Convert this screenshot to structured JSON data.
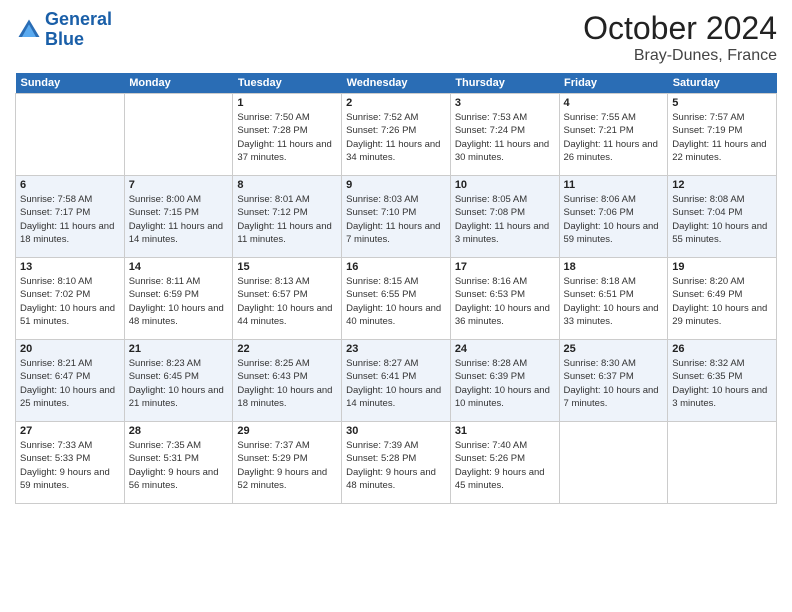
{
  "logo": {
    "line1": "General",
    "line2": "Blue"
  },
  "title": "October 2024",
  "location": "Bray-Dunes, France",
  "headers": [
    "Sunday",
    "Monday",
    "Tuesday",
    "Wednesday",
    "Thursday",
    "Friday",
    "Saturday"
  ],
  "weeks": [
    [
      {
        "date": "",
        "sunrise": "",
        "sunset": "",
        "daylight": ""
      },
      {
        "date": "",
        "sunrise": "",
        "sunset": "",
        "daylight": ""
      },
      {
        "date": "1",
        "sunrise": "Sunrise: 7:50 AM",
        "sunset": "Sunset: 7:28 PM",
        "daylight": "Daylight: 11 hours and 37 minutes."
      },
      {
        "date": "2",
        "sunrise": "Sunrise: 7:52 AM",
        "sunset": "Sunset: 7:26 PM",
        "daylight": "Daylight: 11 hours and 34 minutes."
      },
      {
        "date": "3",
        "sunrise": "Sunrise: 7:53 AM",
        "sunset": "Sunset: 7:24 PM",
        "daylight": "Daylight: 11 hours and 30 minutes."
      },
      {
        "date": "4",
        "sunrise": "Sunrise: 7:55 AM",
        "sunset": "Sunset: 7:21 PM",
        "daylight": "Daylight: 11 hours and 26 minutes."
      },
      {
        "date": "5",
        "sunrise": "Sunrise: 7:57 AM",
        "sunset": "Sunset: 7:19 PM",
        "daylight": "Daylight: 11 hours and 22 minutes."
      }
    ],
    [
      {
        "date": "6",
        "sunrise": "Sunrise: 7:58 AM",
        "sunset": "Sunset: 7:17 PM",
        "daylight": "Daylight: 11 hours and 18 minutes."
      },
      {
        "date": "7",
        "sunrise": "Sunrise: 8:00 AM",
        "sunset": "Sunset: 7:15 PM",
        "daylight": "Daylight: 11 hours and 14 minutes."
      },
      {
        "date": "8",
        "sunrise": "Sunrise: 8:01 AM",
        "sunset": "Sunset: 7:12 PM",
        "daylight": "Daylight: 11 hours and 11 minutes."
      },
      {
        "date": "9",
        "sunrise": "Sunrise: 8:03 AM",
        "sunset": "Sunset: 7:10 PM",
        "daylight": "Daylight: 11 hours and 7 minutes."
      },
      {
        "date": "10",
        "sunrise": "Sunrise: 8:05 AM",
        "sunset": "Sunset: 7:08 PM",
        "daylight": "Daylight: 11 hours and 3 minutes."
      },
      {
        "date": "11",
        "sunrise": "Sunrise: 8:06 AM",
        "sunset": "Sunset: 7:06 PM",
        "daylight": "Daylight: 10 hours and 59 minutes."
      },
      {
        "date": "12",
        "sunrise": "Sunrise: 8:08 AM",
        "sunset": "Sunset: 7:04 PM",
        "daylight": "Daylight: 10 hours and 55 minutes."
      }
    ],
    [
      {
        "date": "13",
        "sunrise": "Sunrise: 8:10 AM",
        "sunset": "Sunset: 7:02 PM",
        "daylight": "Daylight: 10 hours and 51 minutes."
      },
      {
        "date": "14",
        "sunrise": "Sunrise: 8:11 AM",
        "sunset": "Sunset: 6:59 PM",
        "daylight": "Daylight: 10 hours and 48 minutes."
      },
      {
        "date": "15",
        "sunrise": "Sunrise: 8:13 AM",
        "sunset": "Sunset: 6:57 PM",
        "daylight": "Daylight: 10 hours and 44 minutes."
      },
      {
        "date": "16",
        "sunrise": "Sunrise: 8:15 AM",
        "sunset": "Sunset: 6:55 PM",
        "daylight": "Daylight: 10 hours and 40 minutes."
      },
      {
        "date": "17",
        "sunrise": "Sunrise: 8:16 AM",
        "sunset": "Sunset: 6:53 PM",
        "daylight": "Daylight: 10 hours and 36 minutes."
      },
      {
        "date": "18",
        "sunrise": "Sunrise: 8:18 AM",
        "sunset": "Sunset: 6:51 PM",
        "daylight": "Daylight: 10 hours and 33 minutes."
      },
      {
        "date": "19",
        "sunrise": "Sunrise: 8:20 AM",
        "sunset": "Sunset: 6:49 PM",
        "daylight": "Daylight: 10 hours and 29 minutes."
      }
    ],
    [
      {
        "date": "20",
        "sunrise": "Sunrise: 8:21 AM",
        "sunset": "Sunset: 6:47 PM",
        "daylight": "Daylight: 10 hours and 25 minutes."
      },
      {
        "date": "21",
        "sunrise": "Sunrise: 8:23 AM",
        "sunset": "Sunset: 6:45 PM",
        "daylight": "Daylight: 10 hours and 21 minutes."
      },
      {
        "date": "22",
        "sunrise": "Sunrise: 8:25 AM",
        "sunset": "Sunset: 6:43 PM",
        "daylight": "Daylight: 10 hours and 18 minutes."
      },
      {
        "date": "23",
        "sunrise": "Sunrise: 8:27 AM",
        "sunset": "Sunset: 6:41 PM",
        "daylight": "Daylight: 10 hours and 14 minutes."
      },
      {
        "date": "24",
        "sunrise": "Sunrise: 8:28 AM",
        "sunset": "Sunset: 6:39 PM",
        "daylight": "Daylight: 10 hours and 10 minutes."
      },
      {
        "date": "25",
        "sunrise": "Sunrise: 8:30 AM",
        "sunset": "Sunset: 6:37 PM",
        "daylight": "Daylight: 10 hours and 7 minutes."
      },
      {
        "date": "26",
        "sunrise": "Sunrise: 8:32 AM",
        "sunset": "Sunset: 6:35 PM",
        "daylight": "Daylight: 10 hours and 3 minutes."
      }
    ],
    [
      {
        "date": "27",
        "sunrise": "Sunrise: 7:33 AM",
        "sunset": "Sunset: 5:33 PM",
        "daylight": "Daylight: 9 hours and 59 minutes."
      },
      {
        "date": "28",
        "sunrise": "Sunrise: 7:35 AM",
        "sunset": "Sunset: 5:31 PM",
        "daylight": "Daylight: 9 hours and 56 minutes."
      },
      {
        "date": "29",
        "sunrise": "Sunrise: 7:37 AM",
        "sunset": "Sunset: 5:29 PM",
        "daylight": "Daylight: 9 hours and 52 minutes."
      },
      {
        "date": "30",
        "sunrise": "Sunrise: 7:39 AM",
        "sunset": "Sunset: 5:28 PM",
        "daylight": "Daylight: 9 hours and 48 minutes."
      },
      {
        "date": "31",
        "sunrise": "Sunrise: 7:40 AM",
        "sunset": "Sunset: 5:26 PM",
        "daylight": "Daylight: 9 hours and 45 minutes."
      },
      {
        "date": "",
        "sunrise": "",
        "sunset": "",
        "daylight": ""
      },
      {
        "date": "",
        "sunrise": "",
        "sunset": "",
        "daylight": ""
      }
    ]
  ]
}
